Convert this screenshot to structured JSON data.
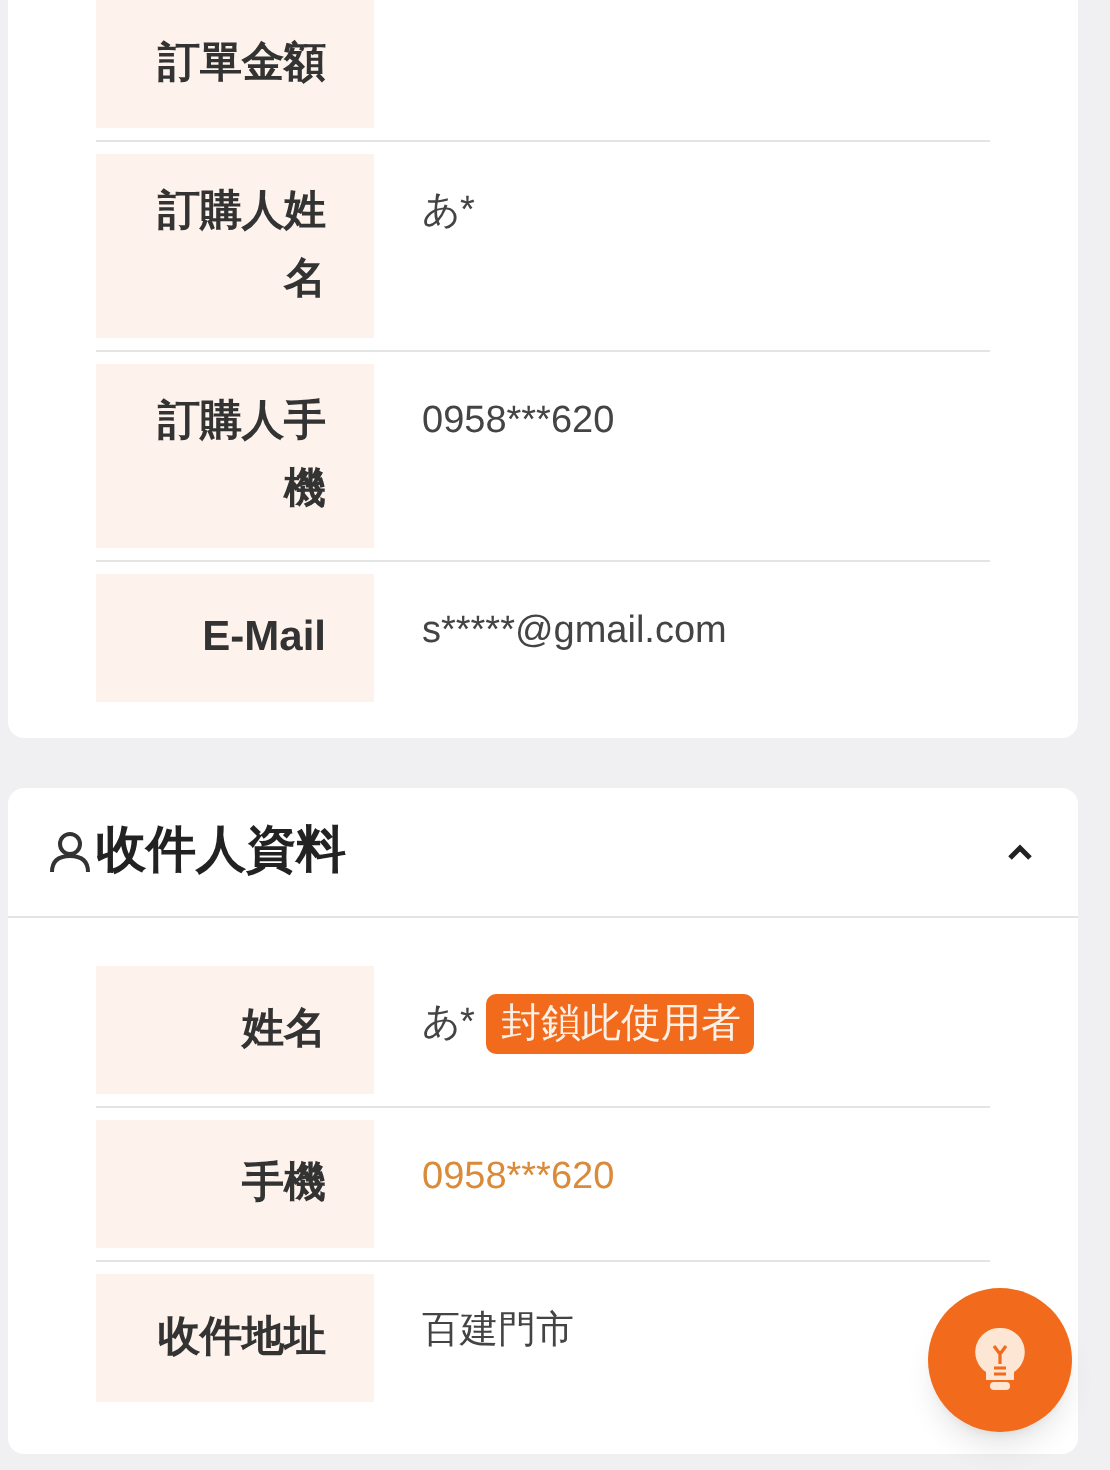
{
  "order_card": {
    "rows": [
      {
        "label": "訂單金額"
      },
      {
        "label": "訂購人姓名",
        "value": "あ*",
        "kind": "text"
      },
      {
        "label": "訂購人手機",
        "value": "0958***620",
        "kind": "text"
      },
      {
        "label": "E-Mail",
        "value": "s*****@gmail.com",
        "kind": "text"
      }
    ]
  },
  "recipient_card": {
    "title": "收件人資料",
    "expanded": true,
    "rows": [
      {
        "label": "姓名",
        "value": "あ*",
        "kind": "text",
        "action": "封鎖此使用者"
      },
      {
        "label": "手機",
        "value": "0958***620",
        "kind": "link"
      },
      {
        "label": "收件地址",
        "value": "百建門市",
        "kind": "text"
      }
    ]
  }
}
